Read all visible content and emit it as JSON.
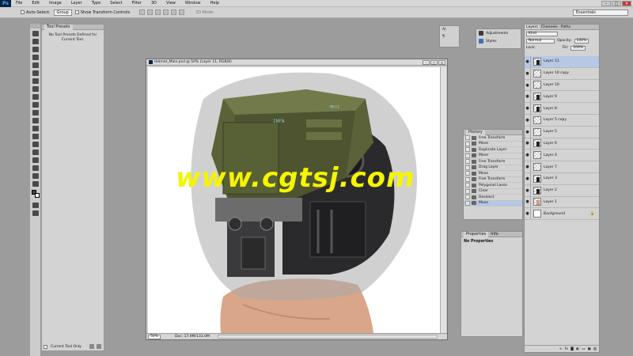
{
  "menubar": {
    "logo": "Ps",
    "items": [
      "File",
      "Edit",
      "Image",
      "Layer",
      "Type",
      "Select",
      "Filter",
      "3D",
      "View",
      "Window",
      "Help"
    ]
  },
  "window_controls": {
    "minimize": "–",
    "maximize": "□",
    "close": "✕"
  },
  "options_bar": {
    "auto_select_label": "Auto-Select:",
    "auto_select_value": "Group",
    "show_transform_label": "Show Transform Controls",
    "mode_3d": "3D Mode:",
    "workspace": "Essentials"
  },
  "tool_presets": {
    "tab": "Tool Presets",
    "message": "No Tool Presets Defined for Current Tool.",
    "current_tool_only": "Current Tool Only"
  },
  "document": {
    "title": "Helmet_Main.psd @ 50% (Layer 11, RGB/8)",
    "zoom": "50%",
    "doc_info": "Doc: 17.9M/133.0M"
  },
  "watermark": "www.cgtsj.com",
  "helmet_text": {
    "a": "INFA",
    "b": "MKII"
  },
  "char_panel": {
    "icon_a": "A|",
    "icon_b": "¶"
  },
  "adjust_panel": {
    "adjustments": "Adjustments",
    "styles": "Styles"
  },
  "history": {
    "tab": "History",
    "items": [
      "Free Transform",
      "Move",
      "Duplicate Layer",
      "Move",
      "Free Transform",
      "Drag Layer",
      "Move",
      "Free Transform",
      "Polygonal Lasso",
      "Clear",
      "Deselect",
      "Move"
    ],
    "selected_index": 11
  },
  "properties": {
    "tabs": [
      "Properties",
      "Info"
    ],
    "title": "No Properties"
  },
  "layers": {
    "tabs": [
      "Layers",
      "Channels",
      "Paths"
    ],
    "kind": "Kind",
    "blend": "Normal",
    "opacity_label": "Opacity:",
    "opacity": "100%",
    "lock_label": "Lock:",
    "fill_label": "Fill:",
    "fill": "100%",
    "items": [
      {
        "name": "Layer 11",
        "selected": true
      },
      {
        "name": "Layer 10 copy",
        "selected": false
      },
      {
        "name": "Layer 10",
        "selected": false
      },
      {
        "name": "Layer 9",
        "selected": false
      },
      {
        "name": "Layer 8",
        "selected": false
      },
      {
        "name": "Layer 5 copy",
        "selected": false
      },
      {
        "name": "Layer 5",
        "selected": false
      },
      {
        "name": "Layer 6",
        "selected": false
      },
      {
        "name": "Layer 4",
        "selected": false
      },
      {
        "name": "Layer 7",
        "selected": false
      },
      {
        "name": "Layer 3",
        "selected": false
      },
      {
        "name": "Layer 2",
        "selected": false
      },
      {
        "name": "Layer 1",
        "selected": false
      },
      {
        "name": "Background",
        "selected": false
      }
    ],
    "footer_icons": [
      "link-icon",
      "fx-icon",
      "mask-icon",
      "adjustment-icon",
      "folder-icon",
      "new-layer-icon",
      "trash-icon"
    ]
  },
  "colors": {
    "chrome": "#d3d3d3",
    "workspace": "#9c9c9c",
    "selected": "#b7c8e6",
    "watermark": "#f5f500"
  }
}
